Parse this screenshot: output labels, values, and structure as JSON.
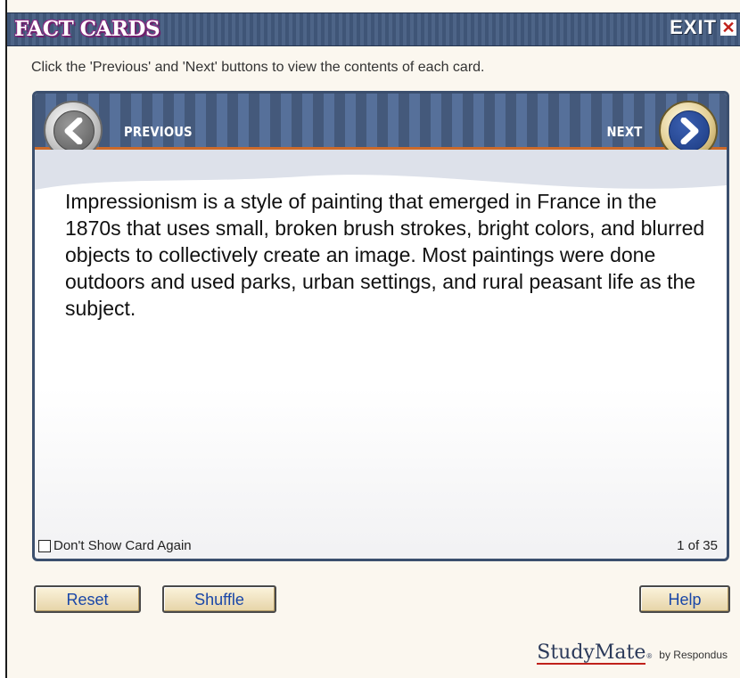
{
  "app": {
    "title": "FACT CARDS",
    "exit_label": "EXIT",
    "exit_icon": "close-icon"
  },
  "instructions": "Click the 'Previous' and 'Next' buttons to view the contents of each card.",
  "card": {
    "previous_label": "PREVIOUS",
    "next_label": "NEXT",
    "text": "Impressionism is a style of painting that emerged in France in the 1870s that uses small, broken brush strokes, bright colors, and blurred objects to collectively create an image. Most paintings were done outdoors and used parks, urban settings, and rural peasant life as the subject.",
    "dont_show_label": "Don't Show Card Again",
    "dont_show_checked": false,
    "counter": "1 of 35"
  },
  "buttons": {
    "reset": "Reset",
    "shuffle": "Shuffle",
    "help": "Help"
  },
  "brand": {
    "name": "StudyMate",
    "by": "by Respondus"
  },
  "colors": {
    "title_bar": "#4d6487",
    "card_border": "#3b4f6e",
    "accent_orange": "#cc6a2a",
    "button_text": "#1a47a8",
    "exit_red": "#c0211b"
  }
}
